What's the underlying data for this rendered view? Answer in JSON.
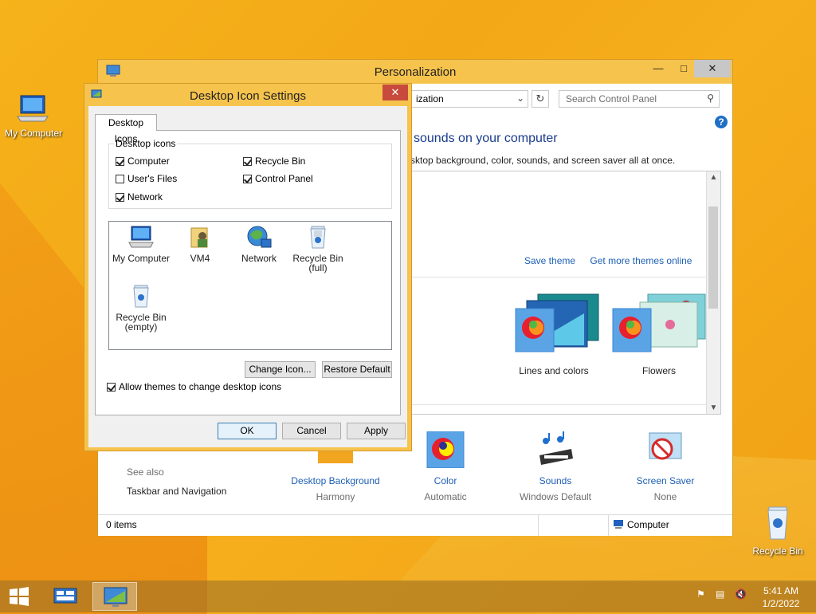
{
  "desktop": {
    "icons": [
      {
        "label": "My Computer",
        "icon": "computer-icon"
      },
      {
        "label": "Recycle Bin",
        "icon": "recycle-bin-icon"
      }
    ]
  },
  "personalization": {
    "title": "Personalization",
    "address_text": "ization",
    "search_placeholder": "Search Control Panel",
    "heading": "sounds on your computer",
    "subheading": "sktop background, color, sounds, and screen saver all at once.",
    "save_theme": "Save theme",
    "get_more_themes": "Get more themes online",
    "themes": [
      {
        "name": "Lines and colors"
      },
      {
        "name": "Flowers"
      }
    ],
    "see_also_label": "See also",
    "see_also_link": "Taskbar and Navigation",
    "bottom": [
      {
        "label": "Desktop Background",
        "sub": "Harmony",
        "icon": "desktop-background-icon"
      },
      {
        "label": "Color",
        "sub": "Automatic",
        "icon": "color-icon"
      },
      {
        "label": "Sounds",
        "sub": "Windows Default",
        "icon": "sounds-icon"
      },
      {
        "label": "Screen Saver",
        "sub": "None",
        "icon": "screen-saver-icon"
      }
    ],
    "status_items": "0 items",
    "status_location": "Computer"
  },
  "dialog": {
    "title": "Desktop Icon Settings",
    "tab": "Desktop Icons",
    "group_label": "Desktop icons",
    "checkboxes": [
      {
        "label": "Computer",
        "checked": true
      },
      {
        "label": "Recycle Bin",
        "checked": true
      },
      {
        "label": "User's Files",
        "checked": false
      },
      {
        "label": "Control Panel",
        "checked": true
      },
      {
        "label": "Network",
        "checked": true
      }
    ],
    "icon_items": [
      {
        "label": "My Computer",
        "icon": "computer-icon"
      },
      {
        "label": "VM4",
        "icon": "user-folder-icon"
      },
      {
        "label": "Network",
        "icon": "network-icon"
      },
      {
        "label": "Recycle Bin",
        "label2": "(full)",
        "icon": "recycle-bin-full-icon"
      },
      {
        "label": "Recycle Bin",
        "label2": "(empty)",
        "icon": "recycle-bin-empty-icon"
      }
    ],
    "change_icon": "Change Icon...",
    "restore_default": "Restore Default",
    "allow_themes": "Allow themes to change desktop icons",
    "allow_themes_checked": true,
    "ok": "OK",
    "cancel": "Cancel",
    "apply": "Apply"
  },
  "taskbar": {
    "time": "5:41 AM",
    "date": "1/2/2022"
  }
}
